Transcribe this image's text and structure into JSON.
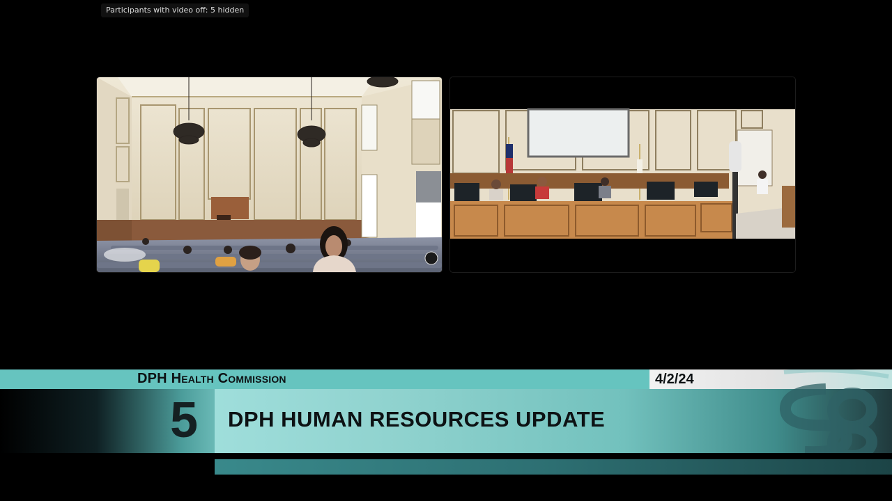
{
  "overlay": {
    "hidden_participants": "Participants with video off: 5 hidden"
  },
  "video_tiles": [
    {
      "name": "courtroom-audience-feed"
    },
    {
      "name": "commission-dais-feed"
    }
  ],
  "lower_third": {
    "organization": "DPH Health Commission",
    "date": "4/2/24",
    "item_number": "5",
    "item_title": "DPH HUMAN RESOURCES UPDATE"
  },
  "colors": {
    "teal_bar": "#66c4bf",
    "dark_text": "#0d1214",
    "background": "#000000"
  }
}
